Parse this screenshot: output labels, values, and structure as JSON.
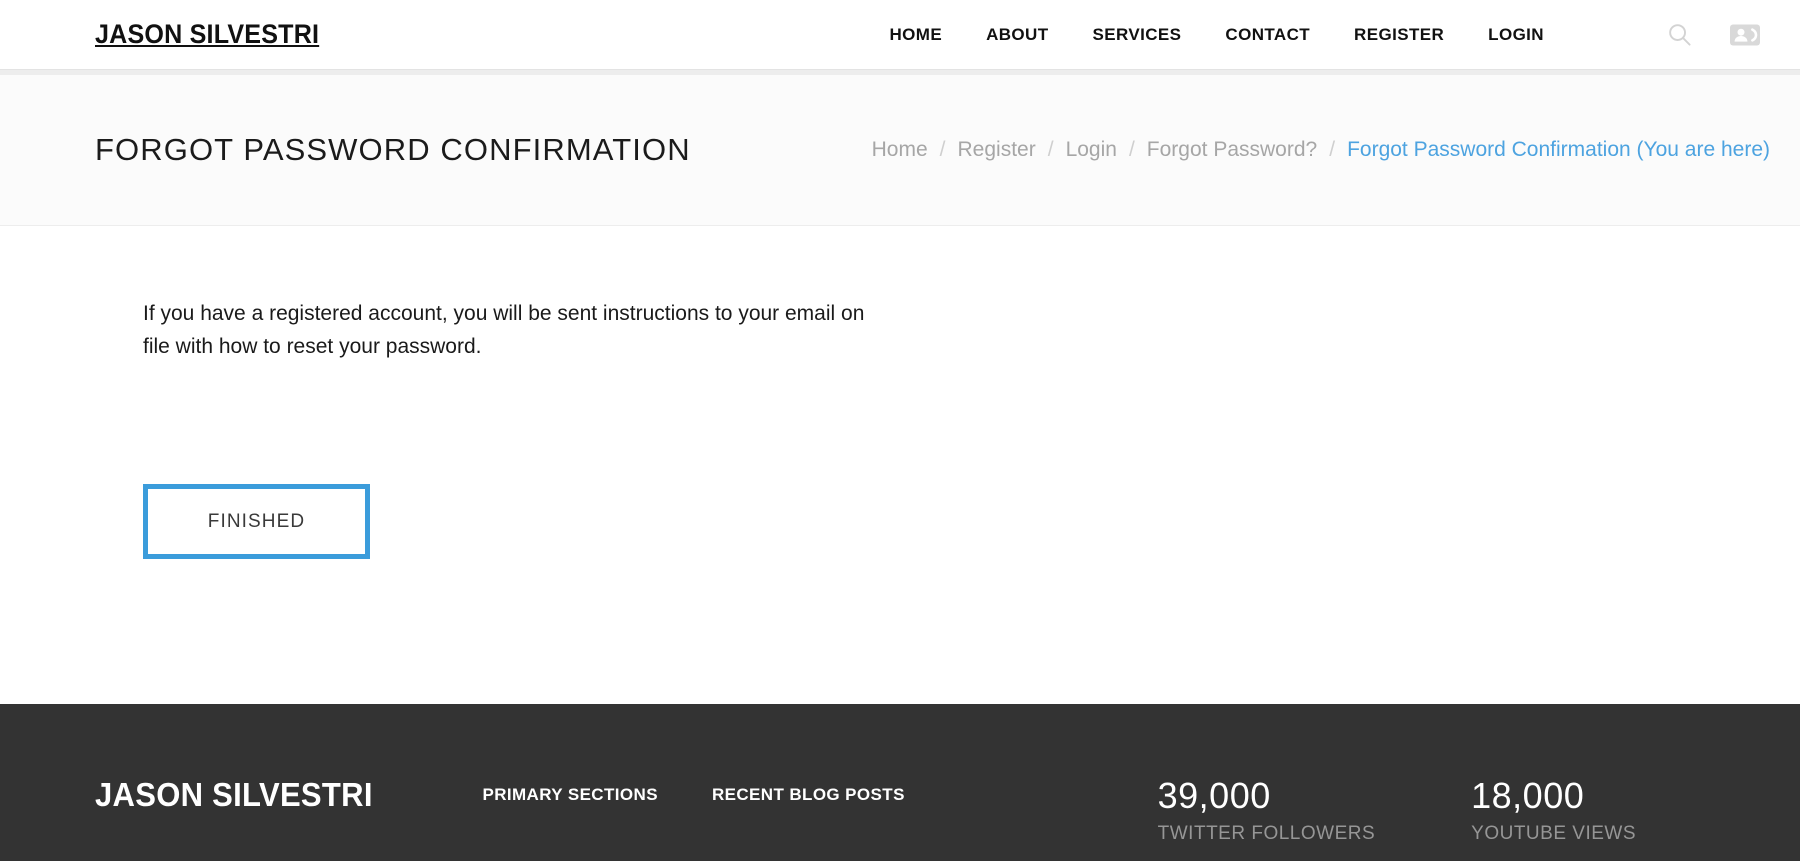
{
  "header": {
    "brand": "JASON SILVESTRI",
    "nav": [
      {
        "label": "HOME"
      },
      {
        "label": "ABOUT"
      },
      {
        "label": "SERVICES"
      },
      {
        "label": "CONTACT"
      },
      {
        "label": "REGISTER"
      },
      {
        "label": "LOGIN"
      }
    ],
    "icons": {
      "search": "search-icon",
      "account": "contact-card-icon"
    }
  },
  "page_bar": {
    "title": "FORGOT PASSWORD CONFIRMATION",
    "breadcrumb": {
      "separator": "/",
      "items": [
        {
          "label": "Home",
          "current": false
        },
        {
          "label": "Register",
          "current": false
        },
        {
          "label": "Login",
          "current": false
        },
        {
          "label": "Forgot Password?",
          "current": false
        },
        {
          "label": "Forgot Password Confirmation (You are here)",
          "current": true
        }
      ]
    }
  },
  "main": {
    "message": "If you have a registered account, you will be sent instructions to your email on file with how to reset your password.",
    "finish_button": "FINISHED"
  },
  "footer": {
    "brand": "JASON SILVESTRI",
    "headings": {
      "primary_sections": "PRIMARY SECTIONS",
      "recent_blog_posts": "RECENT BLOG POSTS"
    },
    "stats": [
      {
        "value": "39,000",
        "label": "TWITTER FOLLOWERS"
      },
      {
        "value": "18,000",
        "label": "YOUTUBE VIEWS"
      }
    ]
  },
  "colors": {
    "accent_blue": "#3b9cdb",
    "link_blue": "#4da3e0",
    "footer_bg": "#333333",
    "muted_gray": "#a6a6a6",
    "page_bar_bg": "#fbfbfb"
  }
}
